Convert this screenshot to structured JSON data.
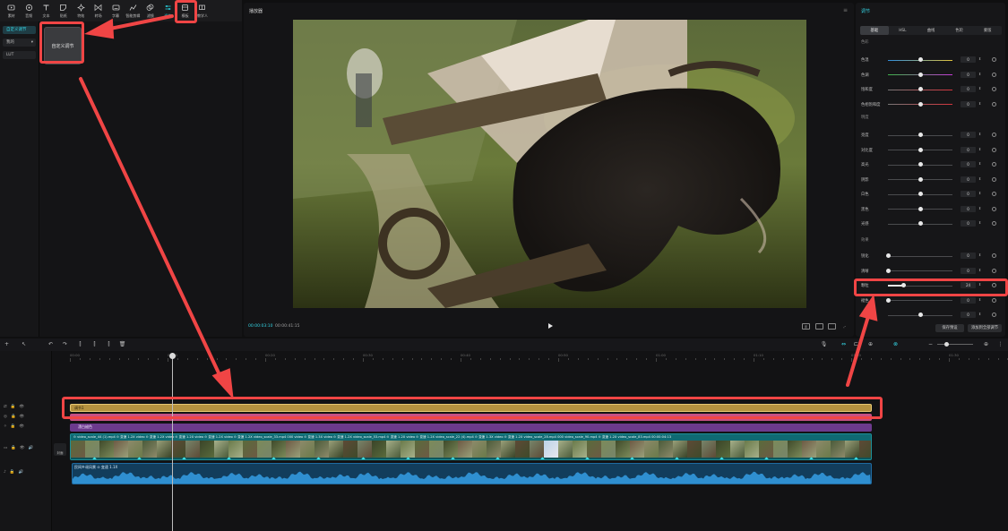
{
  "toolbar": {
    "items": [
      {
        "label": "素材",
        "icon": "media-icon"
      },
      {
        "label": "音频",
        "icon": "audio-icon"
      },
      {
        "label": "文本",
        "icon": "text-icon"
      },
      {
        "label": "贴纸",
        "icon": "sticker-icon"
      },
      {
        "label": "特效",
        "icon": "effects-icon"
      },
      {
        "label": "转场",
        "icon": "transition-icon"
      },
      {
        "label": "字幕",
        "icon": "caption-icon"
      },
      {
        "label": "智能剪辑",
        "icon": "smart-edit-icon"
      },
      {
        "label": "滤镜",
        "icon": "filter-icon"
      },
      {
        "label": "调节",
        "icon": "adjust-icon",
        "active": true
      },
      {
        "label": "模板",
        "icon": "template-icon"
      },
      {
        "label": "教学人",
        "icon": "tutorial-icon"
      }
    ]
  },
  "left_sidebar": {
    "items": [
      {
        "label": "自定义调节",
        "active": true
      },
      {
        "label": "我的",
        "dropdown": true
      },
      {
        "label": "LUT"
      }
    ]
  },
  "left_content": {
    "card_label": "自定义调节"
  },
  "player": {
    "title": "播放器",
    "current_time": "00:00:03:10",
    "total_time": "00:00:41:15",
    "ctrl_labels": [
      "原",
      "",
      "",
      ""
    ]
  },
  "right_panel": {
    "title": "调节",
    "tabs": [
      {
        "label": "基础",
        "active": true
      },
      {
        "label": "HSL"
      },
      {
        "label": "曲线"
      },
      {
        "label": "色轮"
      },
      {
        "label": "蒙版"
      }
    ],
    "groups": [
      "色彩",
      "明度",
      "效果"
    ],
    "color_sliders": [
      {
        "label": "色温",
        "value": "0",
        "pos": 0.5,
        "gradient": [
          "#2f8ddc",
          "#e0c23c"
        ]
      },
      {
        "label": "色调",
        "value": "0",
        "pos": 0.5,
        "gradient": [
          "#3db54a",
          "#c53bd6"
        ]
      },
      {
        "label": "饱和度",
        "value": "0",
        "pos": 0.5,
        "gradient": [
          "#777777",
          "#d3353d"
        ]
      },
      {
        "label": "色相饱和度",
        "value": "0",
        "pos": 0.5,
        "gradient": [
          "#777777",
          "#d3353d"
        ]
      }
    ],
    "light_sliders": [
      {
        "label": "亮度",
        "value": "0",
        "pos": 0.5
      },
      {
        "label": "对比度",
        "value": "0",
        "pos": 0.5
      },
      {
        "label": "高光",
        "value": "0",
        "pos": 0.5
      },
      {
        "label": "阴影",
        "value": "0",
        "pos": 0.5
      },
      {
        "label": "白色",
        "value": "0",
        "pos": 0.5
      },
      {
        "label": "黑色",
        "value": "0",
        "pos": 0.5
      },
      {
        "label": "光感",
        "value": "0",
        "pos": 0.5
      }
    ],
    "effect_sliders": [
      {
        "label": "锐化",
        "value": "0",
        "pos": 0.0
      },
      {
        "label": "清晰",
        "value": "0",
        "pos": 0.0
      },
      {
        "label": "颗粒",
        "value": "24",
        "pos": 0.24,
        "highlighted": true
      },
      {
        "label": "褪色",
        "value": "0",
        "pos": 0.0
      },
      {
        "label": "",
        "value": "0",
        "pos": 0.5
      }
    ],
    "buttons": {
      "save_preset": "保存预设",
      "apply_all": "添加到全部调节"
    }
  },
  "timeline": {
    "ruler": [
      "00:00",
      "00:10",
      "00:20",
      "00:30",
      "00:40",
      "00:50",
      "01:00",
      "01:10",
      "01:20",
      "01:30"
    ],
    "adjust_clip_label": "调节1",
    "purple_clip_label": "漂白褪色",
    "video_clip_labels": "⊙ video_scale_44 (1).mp4  ⊙ 变速 1.2X  video  ⊙ 变速 1.2X  video  ⊙ 变速 1.2X  video  ⊙ 变速 1.2X  video  ⊙ 变速 1.2X  video_scale_33.mp4  000  video  ⊙ 变速 1.3X  video  ⊙ 变速 1.2X  video_scale_53.mp4  ⊙ 变速 1.2X  video  ⊙ 变速 1.2X  video_scale_22 (4).mp4  ⊙ 变速 1.3X  video  ⊙ 变速 1.2X  video_scale_28.mp4  000  video_scale_90.mp4  ⊙ 变速 1.2X  video_scale_83.mp4  00:00:04:13",
    "audio_clip_label": "民间乡谣风景  ⊙ 变速 1.1X",
    "cover_label": "封面"
  },
  "colors": {
    "accent": "#35d6e6",
    "annotation": "#f04545"
  }
}
